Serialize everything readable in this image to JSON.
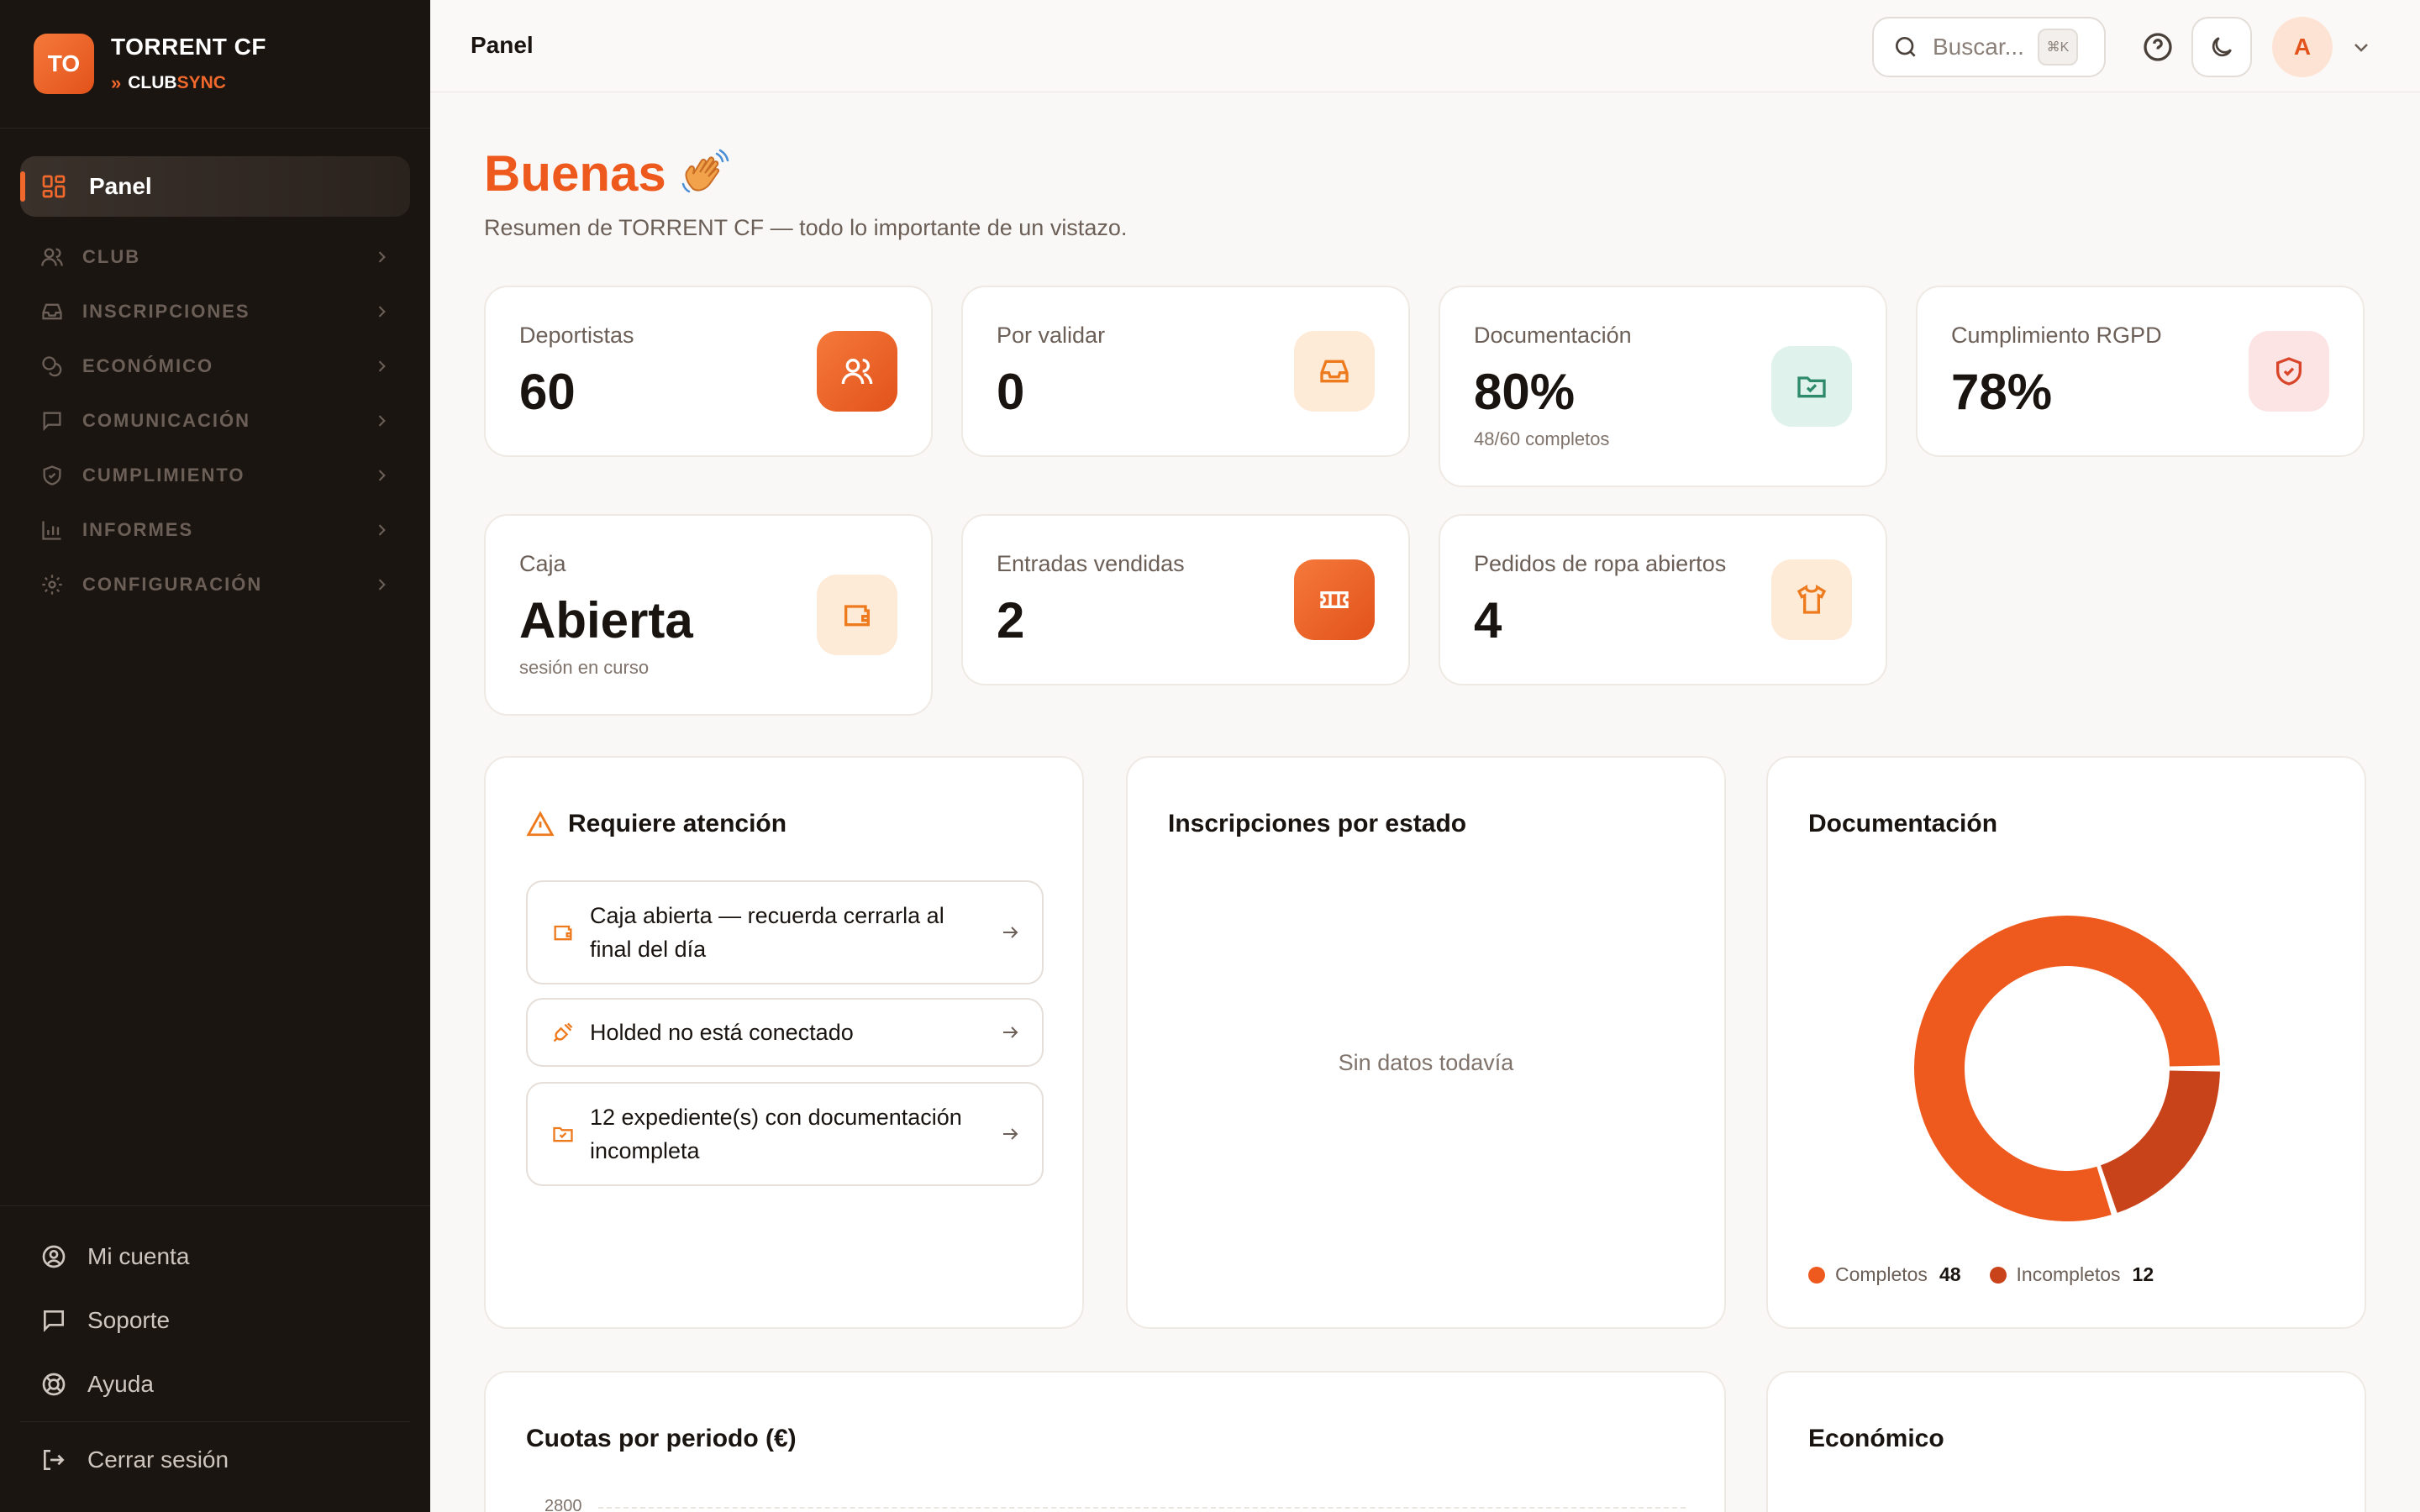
{
  "brand": {
    "initials": "TO",
    "name": "TORRENT CF",
    "sub_club": "CLUB",
    "sub_sync": "SYNC"
  },
  "sidebar": {
    "active": {
      "label": "Panel"
    },
    "groups": [
      {
        "label": "CLUB",
        "icon": "users-icon"
      },
      {
        "label": "INSCRIPCIONES",
        "icon": "inbox-icon"
      },
      {
        "label": "ECONÓMICO",
        "icon": "coins-icon"
      },
      {
        "label": "COMUNICACIÓN",
        "icon": "message-icon"
      },
      {
        "label": "CUMPLIMIENTO",
        "icon": "shield-icon"
      },
      {
        "label": "INFORMES",
        "icon": "bar-chart-icon"
      },
      {
        "label": "CONFIGURACIÓN",
        "icon": "gear-icon"
      }
    ],
    "footer": [
      {
        "label": "Mi cuenta",
        "icon": "user-circle-icon"
      },
      {
        "label": "Soporte",
        "icon": "message-icon"
      },
      {
        "label": "Ayuda",
        "icon": "lifebuoy-icon"
      }
    ],
    "logout": "Cerrar sesión"
  },
  "header": {
    "title": "Panel",
    "search_placeholder": "Buscar...",
    "search_kbd": "⌘K",
    "avatar_initial": "A"
  },
  "greeting": {
    "title": "Buenas",
    "subtitle": "Resumen de TORRENT CF — todo lo importante de un vistazo."
  },
  "stats": [
    {
      "label": "Deportistas",
      "value": "60",
      "sub": "",
      "icon": "users-icon"
    },
    {
      "label": "Por validar",
      "value": "0",
      "sub": "",
      "icon": "inbox-icon"
    },
    {
      "label": "Documentación",
      "value": "80%",
      "sub": "48/60 completos",
      "icon": "folder-check-icon"
    },
    {
      "label": "Cumplimiento RGPD",
      "value": "78%",
      "sub": "",
      "icon": "shield-check-icon"
    },
    {
      "label": "Caja",
      "value": "Abierta",
      "sub": "sesión en curso",
      "icon": "wallet-icon"
    },
    {
      "label": "Entradas vendidas",
      "value": "2",
      "sub": "",
      "icon": "ticket-icon"
    },
    {
      "label": "Pedidos de ropa abiertos",
      "value": "4",
      "sub": "",
      "icon": "shirt-icon"
    }
  ],
  "attention": {
    "title": "Requiere atención",
    "items": [
      {
        "text": "Caja abierta — recuerda cerrarla al final del día",
        "icon": "wallet-icon"
      },
      {
        "text": "Holded no está conectado",
        "icon": "plug-icon"
      },
      {
        "text": "12 expediente(s) con documentación incompleta",
        "icon": "folder-icon"
      }
    ]
  },
  "inscripciones": {
    "title": "Inscripciones por estado",
    "empty": "Sin datos todavía"
  },
  "documentacion": {
    "title": "Documentación"
  },
  "cuotas": {
    "title": "Cuotas por periodo (€)",
    "tick_top": "2800"
  },
  "economico": {
    "title": "Económico"
  },
  "colors": {
    "accent": "#ee5a1e",
    "accent_dark": "#c9431a",
    "sidebar_bg": "#1a1511"
  },
  "chart_data": {
    "type": "pie",
    "title": "Documentación",
    "categories": [
      "Completos",
      "Incompletos"
    ],
    "values": [
      48,
      12
    ],
    "colors": [
      "#ee5a1e",
      "#c9431a"
    ],
    "donut": true,
    "legend": "bottom-left"
  }
}
